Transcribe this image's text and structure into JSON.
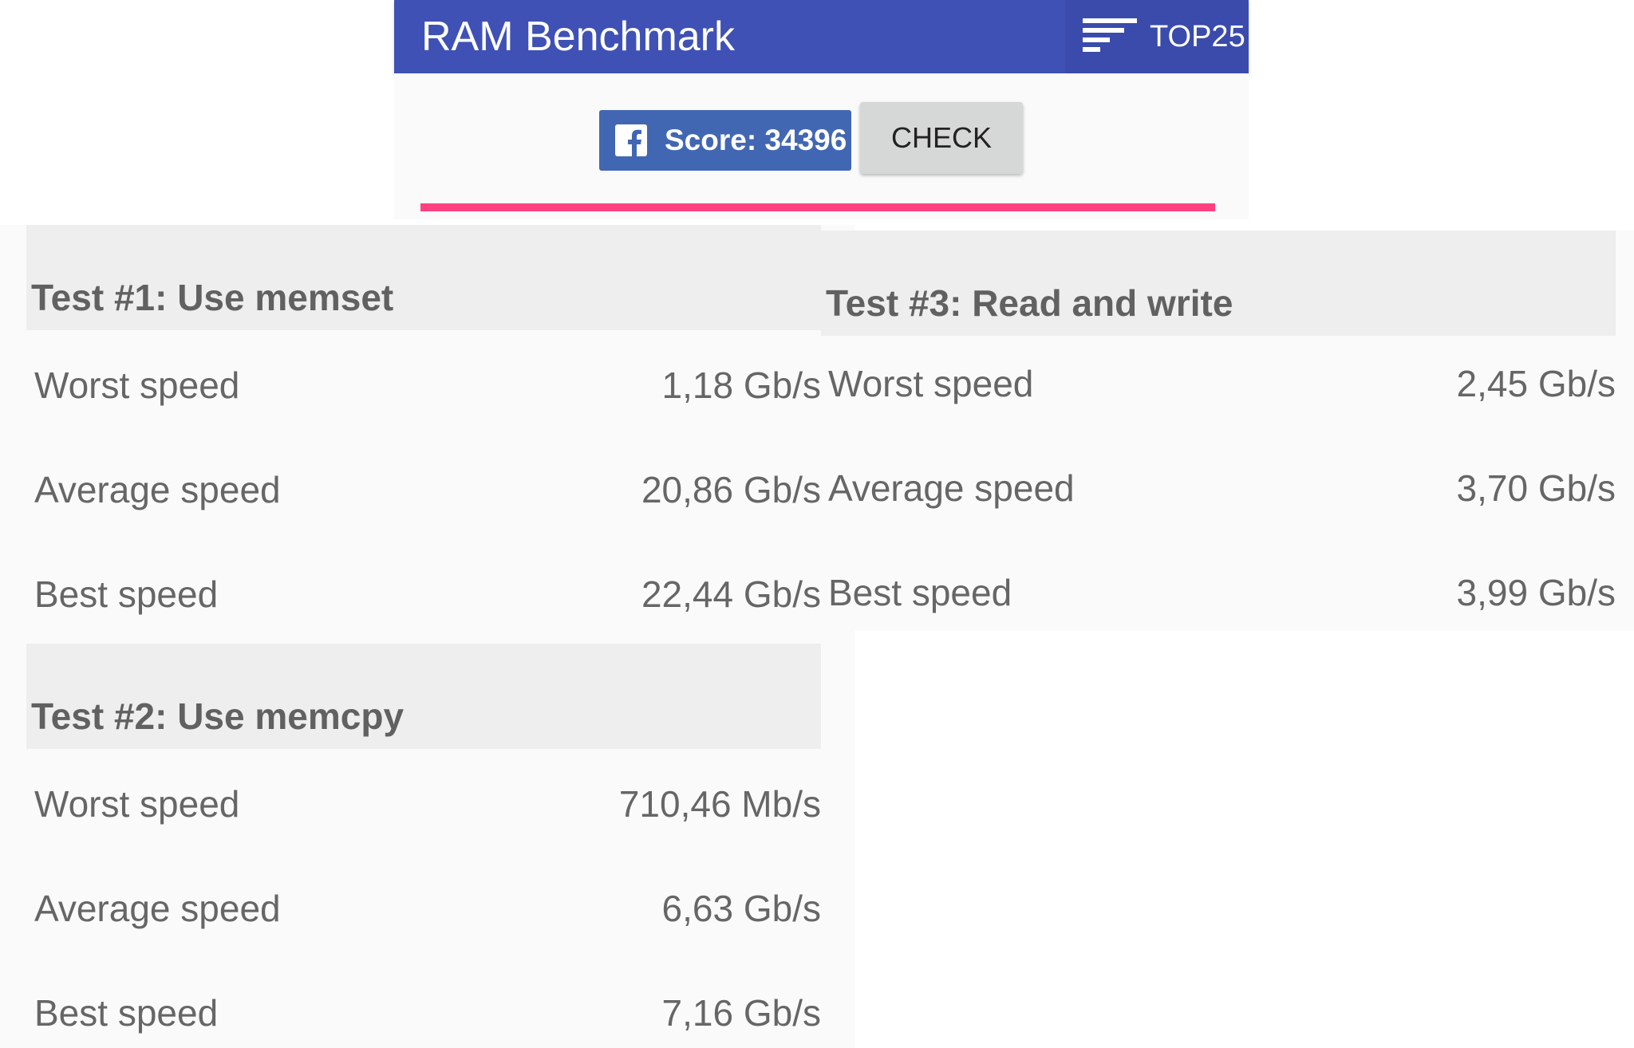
{
  "app": {
    "title": "RAM Benchmark",
    "top25_label": "TOP25"
  },
  "score": {
    "share_label": "Score: 34396",
    "check_label": "CHECK"
  },
  "colors": {
    "app_bar": "#3f51b5",
    "facebook": "#4267b2",
    "progress": "#ff4081"
  },
  "tests": [
    {
      "title": "Test #1: Use memset",
      "rows": [
        {
          "label": "Worst speed",
          "value": "1,18 Gb/s"
        },
        {
          "label": "Average speed",
          "value": "20,86 Gb/s"
        },
        {
          "label": "Best speed",
          "value": "22,44 Gb/s"
        }
      ]
    },
    {
      "title": "Test #2: Use memcpy",
      "rows": [
        {
          "label": "Worst speed",
          "value": "710,46 Mb/s"
        },
        {
          "label": "Average speed",
          "value": "6,63 Gb/s"
        },
        {
          "label": "Best speed",
          "value": "7,16 Gb/s"
        }
      ]
    },
    {
      "title": "Test #3: Read and write",
      "rows": [
        {
          "label": "Worst speed",
          "value": "2,45 Gb/s"
        },
        {
          "label": "Average speed",
          "value": "3,70 Gb/s"
        },
        {
          "label": "Best speed",
          "value": "3,99 Gb/s"
        }
      ]
    }
  ]
}
